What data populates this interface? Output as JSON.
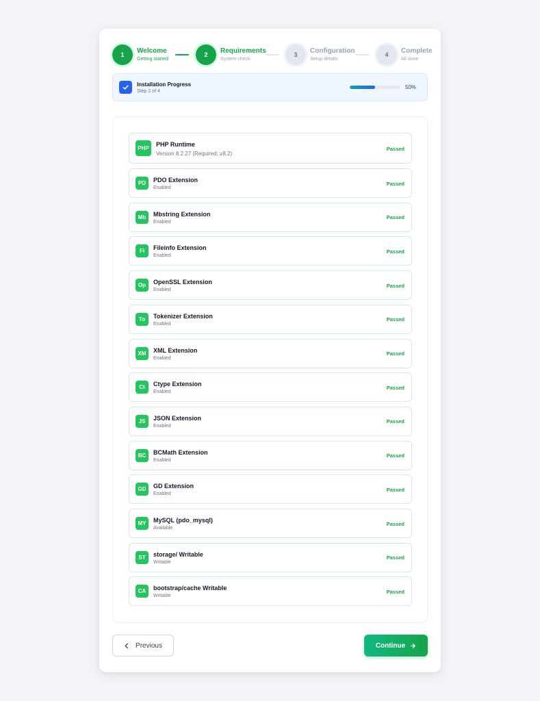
{
  "stepper": {
    "steps": [
      {
        "number": "1",
        "title": "Welcome",
        "subtitle": "Getting started",
        "state": "done"
      },
      {
        "number": "2",
        "title": "Requirements",
        "subtitle": "System check",
        "state": "active"
      },
      {
        "number": "3",
        "title": "Configuration",
        "subtitle": "Setup details",
        "state": "todo"
      },
      {
        "number": "4",
        "title": "Complete",
        "subtitle": "All done",
        "state": "todo"
      }
    ]
  },
  "progress": {
    "title": "Installation Progress",
    "subtitle": "Step 2 of 4",
    "percent_label": "50%",
    "percent": 50
  },
  "requirements": [
    {
      "abbr": "PHP",
      "name": "PHP Runtime",
      "detail": "Version 8.2.27 (Required: ≥8.2)",
      "status": "Passed"
    },
    {
      "abbr": "PD",
      "name": "PDO Extension",
      "detail": "Enabled",
      "status": "Passed"
    },
    {
      "abbr": "Mb",
      "name": "Mbstring Extension",
      "detail": "Enabled",
      "status": "Passed"
    },
    {
      "abbr": "Fi",
      "name": "Fileinfo Extension",
      "detail": "Enabled",
      "status": "Passed"
    },
    {
      "abbr": "Op",
      "name": "OpenSSL Extension",
      "detail": "Enabled",
      "status": "Passed"
    },
    {
      "abbr": "To",
      "name": "Tokenizer Extension",
      "detail": "Enabled",
      "status": "Passed"
    },
    {
      "abbr": "XM",
      "name": "XML Extension",
      "detail": "Enabled",
      "status": "Passed"
    },
    {
      "abbr": "Ct",
      "name": "Ctype Extension",
      "detail": "Enabled",
      "status": "Passed"
    },
    {
      "abbr": "JS",
      "name": "JSON Extension",
      "detail": "Enabled",
      "status": "Passed"
    },
    {
      "abbr": "BC",
      "name": "BCMath Extension",
      "detail": "Enabled",
      "status": "Passed"
    },
    {
      "abbr": "GD",
      "name": "GD Extension",
      "detail": "Enabled",
      "status": "Passed"
    },
    {
      "abbr": "MY",
      "name": "MySQL (pdo_mysql)",
      "detail": "Available",
      "status": "Passed"
    },
    {
      "abbr": "ST",
      "name": "storage/ Writable",
      "detail": "Writable",
      "status": "Passed"
    },
    {
      "abbr": "CA",
      "name": "bootstrap/cache Writable",
      "detail": "Writable",
      "status": "Passed"
    }
  ],
  "footer": {
    "previous_label": "Previous",
    "continue_label": "Continue"
  },
  "colors": {
    "accent": "#16a34a",
    "primary_blue": "#2563eb"
  }
}
